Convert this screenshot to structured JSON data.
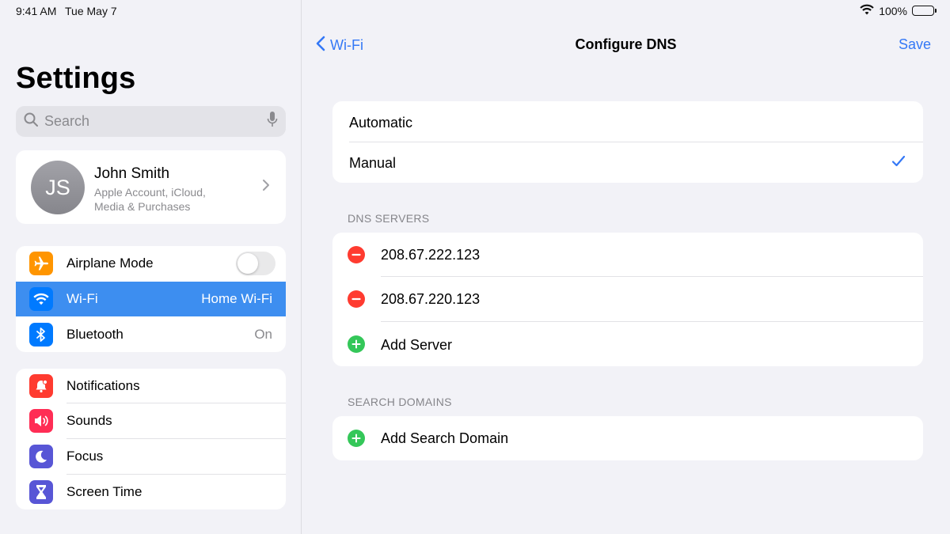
{
  "status_bar": {
    "time": "9:41 AM",
    "date": "Tue May 7",
    "battery": "100%"
  },
  "sidebar": {
    "title": "Settings",
    "search": {
      "placeholder": "Search"
    },
    "account": {
      "initials": "JS",
      "name": "John Smith",
      "subtitle": "Apple Account, iCloud, Media & Purchases"
    },
    "group1": [
      {
        "label": "Airplane Mode",
        "icon": "airplane-icon",
        "color": "#ff9500",
        "toggle": false
      },
      {
        "label": "Wi-Fi",
        "value": "Home Wi-Fi",
        "icon": "wifi-icon",
        "color": "#007aff",
        "selected": true
      },
      {
        "label": "Bluetooth",
        "value": "On",
        "icon": "bluetooth-icon",
        "color": "#007aff"
      }
    ],
    "group2": [
      {
        "label": "Notifications",
        "icon": "bell-icon",
        "color": "#ff3b30"
      },
      {
        "label": "Sounds",
        "icon": "speaker-icon",
        "color": "#ff2d55"
      },
      {
        "label": "Focus",
        "icon": "moon-icon",
        "color": "#5856d6"
      },
      {
        "label": "Screen Time",
        "icon": "hourglass-icon",
        "color": "#5856d6"
      }
    ]
  },
  "detail": {
    "nav": {
      "back_label": "Wi-Fi",
      "title": "Configure DNS",
      "save_label": "Save"
    },
    "mode_options": [
      {
        "label": "Automatic",
        "selected": false
      },
      {
        "label": "Manual",
        "selected": true
      }
    ],
    "dns_servers": {
      "header": "DNS SERVERS",
      "servers": [
        "208.67.222.123",
        "208.67.220.123"
      ],
      "add_label": "Add Server"
    },
    "search_domains": {
      "header": "SEARCH DOMAINS",
      "add_label": "Add Search Domain"
    }
  },
  "colors": {
    "accent": "#3478f6",
    "selected_row": "#3d8ef0",
    "delete": "#ff3b30",
    "add": "#34c759"
  }
}
